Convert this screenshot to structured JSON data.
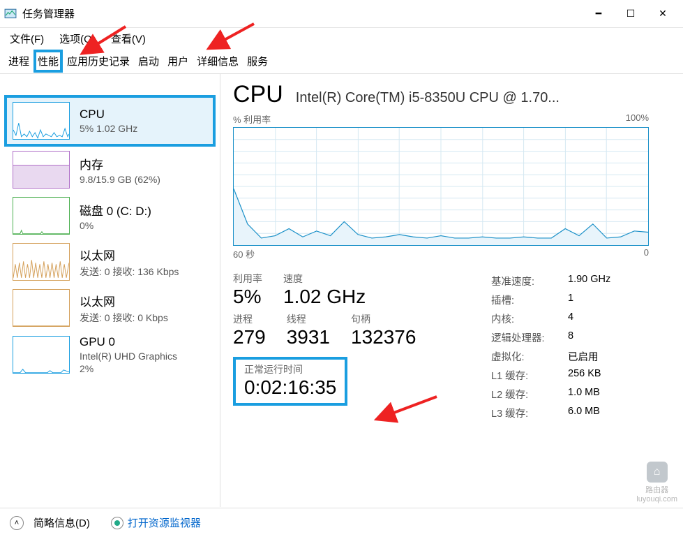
{
  "window": {
    "title": "任务管理器"
  },
  "menu": {
    "file": "文件(F)",
    "options": "选项(O)",
    "view": "查看(V)"
  },
  "tabs": {
    "processes": "进程",
    "performance": "性能",
    "apphistory": "应用历史记录",
    "startup": "启动",
    "users": "用户",
    "details": "详细信息",
    "services": "服务"
  },
  "sidebar": {
    "cpu": {
      "title": "CPU",
      "sub": "5%  1.02 GHz"
    },
    "mem": {
      "title": "内存",
      "sub": "9.8/15.9 GB (62%)"
    },
    "disk": {
      "title": "磁盘 0 (C: D:)",
      "sub": "0%"
    },
    "eth1": {
      "title": "以太网",
      "sub": "发送: 0 接收: 136 Kbps"
    },
    "eth2": {
      "title": "以太网",
      "sub": "发送: 0 接收: 0 Kbps"
    },
    "gpu": {
      "title": "GPU 0",
      "sub1": "Intel(R) UHD Graphics",
      "sub2": "2%"
    }
  },
  "detail": {
    "heading": "CPU",
    "model": "Intel(R) Core(TM) i5-8350U CPU @ 1.70...",
    "chart_ylabel": "% 利用率",
    "chart_ymax": "100%",
    "chart_xleft": "60 秒",
    "chart_xright": "0",
    "stats": {
      "util_label": "利用率",
      "util_value": "5%",
      "speed_label": "速度",
      "speed_value": "1.02 GHz",
      "proc_label": "进程",
      "proc_value": "279",
      "thread_label": "线程",
      "thread_value": "3931",
      "handle_label": "句柄",
      "handle_value": "132376",
      "uptime_label": "正常运行时间",
      "uptime_value": "0:02:16:35"
    },
    "specs": {
      "base_label": "基准速度:",
      "base_value": "1.90 GHz",
      "sockets_label": "插槽:",
      "sockets_value": "1",
      "cores_label": "内核:",
      "cores_value": "4",
      "lproc_label": "逻辑处理器:",
      "lproc_value": "8",
      "virt_label": "虚拟化:",
      "virt_value": "已启用",
      "l1_label": "L1 缓存:",
      "l1_value": "256 KB",
      "l2_label": "L2 缓存:",
      "l2_value": "1.0 MB",
      "l3_label": "L3 缓存:",
      "l3_value": "6.0 MB"
    }
  },
  "footer": {
    "brief": "简略信息(D)",
    "monitor": "打开资源监视器"
  },
  "watermark": {
    "label": "路由器",
    "url": "luyouqi.com"
  },
  "chart_data": {
    "type": "line",
    "title": "% 利用率",
    "xlabel": "60 秒 → 0",
    "ylabel": "% 利用率",
    "ylim": [
      0,
      100
    ],
    "x_seconds_ago": [
      60,
      58,
      56,
      54,
      52,
      50,
      48,
      46,
      44,
      42,
      40,
      38,
      36,
      34,
      32,
      30,
      28,
      26,
      24,
      22,
      20,
      18,
      16,
      14,
      12,
      10,
      8,
      6,
      4,
      2,
      0
    ],
    "values": [
      48,
      18,
      6,
      8,
      14,
      7,
      12,
      8,
      20,
      9,
      6,
      7,
      9,
      7,
      6,
      8,
      6,
      6,
      7,
      6,
      6,
      7,
      6,
      6,
      14,
      8,
      18,
      6,
      7,
      12,
      11
    ]
  }
}
